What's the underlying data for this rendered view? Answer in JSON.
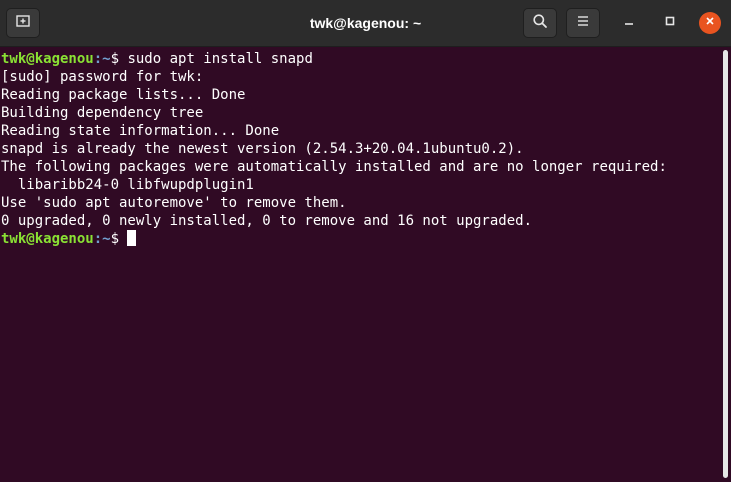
{
  "window": {
    "title": "twk@kagenou: ~"
  },
  "header": {
    "new_tab_icon": "new-tab-icon",
    "search_icon": "search-icon",
    "menu_icon": "hamburger-menu-icon",
    "minimize_icon": "minimize-icon",
    "maximize_icon": "maximize-icon",
    "close_icon": "close-icon",
    "close_color": "#e95420"
  },
  "terminal": {
    "background": "#300a24",
    "prompt_user_color": "#8ae234",
    "prompt_path_color": "#729fcf",
    "prompt1": {
      "user_host": "twk@kagenou",
      "path": ":~",
      "symbol": "$ ",
      "command": "sudo apt install snapd"
    },
    "output": [
      "[sudo] password for twk:",
      "Reading package lists... Done",
      "Building dependency tree",
      "Reading state information... Done",
      "snapd is already the newest version (2.54.3+20.04.1ubuntu0.2).",
      "The following packages were automatically installed and are no longer required:",
      "  libaribb24-0 libfwupdplugin1",
      "Use 'sudo apt autoremove' to remove them.",
      "0 upgraded, 0 newly installed, 0 to remove and 16 not upgraded."
    ],
    "prompt2": {
      "user_host": "twk@kagenou",
      "path": ":~",
      "symbol": "$ "
    }
  }
}
